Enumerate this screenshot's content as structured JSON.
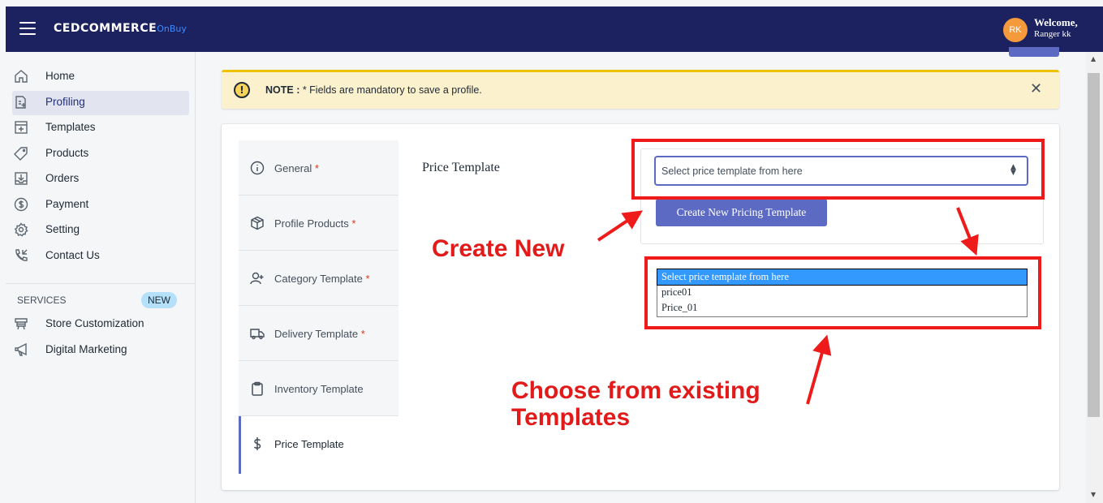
{
  "header": {
    "brand": "CEDCOMMERCE",
    "brand_sub": "OnBuy",
    "avatar_initials": "RK",
    "welcome": "Welcome,",
    "user_name": "Ranger kk"
  },
  "sidebar": {
    "items": [
      {
        "label": "Home",
        "icon": "home-icon"
      },
      {
        "label": "Profiling",
        "icon": "profiling-icon",
        "active": true
      },
      {
        "label": "Templates",
        "icon": "templates-icon"
      },
      {
        "label": "Products",
        "icon": "tag-icon"
      },
      {
        "label": "Orders",
        "icon": "orders-icon"
      },
      {
        "label": "Payment",
        "icon": "dollar-circle-icon"
      },
      {
        "label": "Setting",
        "icon": "gear-icon"
      },
      {
        "label": "Contact Us",
        "icon": "phone-icon"
      }
    ],
    "services_label": "SERVICES",
    "new_badge": "NEW",
    "services": [
      {
        "label": "Store Customization",
        "icon": "store-icon"
      },
      {
        "label": "Digital Marketing",
        "icon": "megaphone-icon"
      }
    ]
  },
  "notice": {
    "bold": "NOTE :",
    "text": " * Fields are mandatory to save a profile.",
    "close": "✕"
  },
  "tabs": [
    {
      "label": "General",
      "required": "*",
      "icon": "info-icon"
    },
    {
      "label": "Profile Products",
      "required": "*",
      "icon": "box-icon"
    },
    {
      "label": "Category Template",
      "required": "*",
      "icon": "user-plus-icon"
    },
    {
      "label": "Delivery Template",
      "required": "*",
      "icon": "truck-icon"
    },
    {
      "label": "Inventory Template",
      "required": "",
      "icon": "clipboard-icon"
    },
    {
      "label": "Price Template",
      "required": "",
      "icon": "dollar-icon",
      "active": true
    }
  ],
  "price_template": {
    "label": "Price Template",
    "select_placeholder": "Select price template from here",
    "create_button": "Create New Pricing Template",
    "options": [
      "Select price template from here",
      "price01",
      "Price_01"
    ],
    "selected_option": "Select price template from here"
  },
  "annotations": {
    "create_new": "Create New",
    "choose_line1": "Choose from existing",
    "choose_line2": "Templates",
    "color": "#e21a1a"
  },
  "colors": {
    "topbar": "#1c2260",
    "accent": "#5c6ac4",
    "notice_bg": "#fcf1cd",
    "annotation_red": "#ef1a1a"
  }
}
